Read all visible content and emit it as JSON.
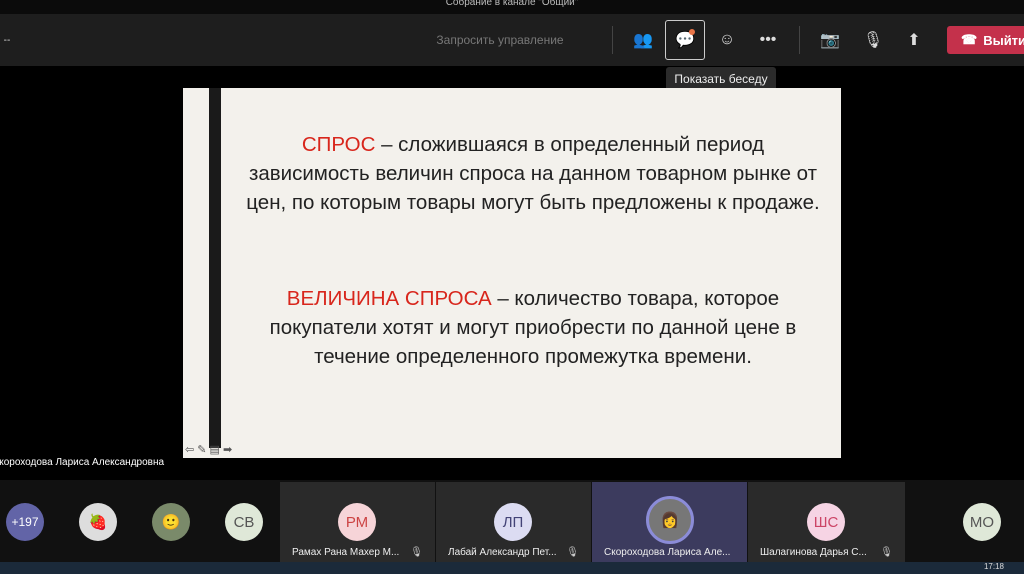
{
  "window_title": "Собрание в канале \"Общий\"",
  "toolbar": {
    "timer": "--",
    "request_control": "Запросить управление",
    "more": "•••",
    "leave": "Выйти",
    "tooltip": "Показать беседу"
  },
  "slide": {
    "p1_term": "СПРОС",
    "p1_text": " – сложившаяся в определенный период зависимость величин спроса на данном товарном рынке от цен, по которым товары могут быть предложены к продаже.",
    "p2_term": "ВЕЛИЧИНА СПРОСА",
    "p2_text": " – количество товара, которое покупатели хотят и могут приобрести по данной цене в течение определенного промежутка времени."
  },
  "presenter_name": "Скороходова Лариса Александровна",
  "participants": {
    "overflow": "+197",
    "avatars": [
      "СВ",
      "МО"
    ],
    "tiles": [
      {
        "initials": "РМ",
        "name": "Рамах Рана Махер М...",
        "color": "#f6d4d8"
      },
      {
        "initials": "ЛП",
        "name": "Лабай Александр Пет...",
        "color": "#dcdcf2"
      },
      {
        "initials": "",
        "name": "Скороходова Лариса Але...",
        "color": "#888"
      },
      {
        "initials": "ШС",
        "name": "Шалагинова Дарья С...",
        "color": "#f6d4e4"
      }
    ]
  },
  "taskbar": {
    "time": "17:18"
  }
}
